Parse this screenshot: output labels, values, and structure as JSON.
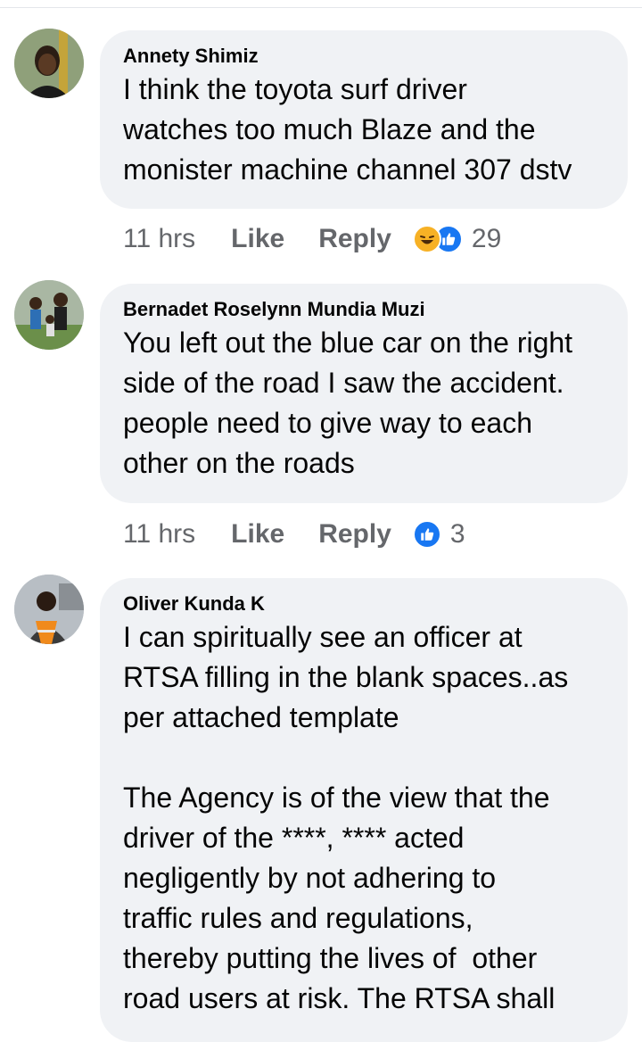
{
  "comments": [
    {
      "author": "Annety Shimiz",
      "text": "I think the toyota surf driver\nwatches too much Blaze and the\nmonister machine channel 307 dstv",
      "time": "11 hrs",
      "like_label": "Like",
      "reply_label": "Reply",
      "reactions": [
        "haha-icon",
        "like-icon"
      ],
      "reaction_count": "29"
    },
    {
      "author": "Bernadet Roselynn Mundia Muzi",
      "text": "You left out the blue car on the right\nside of the road I saw the accident.\npeople need to give way to each\nother on the roads",
      "time": "11 hrs",
      "like_label": "Like",
      "reply_label": "Reply",
      "reactions": [
        "like-icon"
      ],
      "reaction_count": "3"
    },
    {
      "author": "Oliver Kunda K",
      "text": "I can spiritually see an officer at\nRTSA filling in the blank spaces..as\nper attached template\n\nThe Agency is of the view that the\ndriver of the ****, **** acted\nnegligently by not adhering to\ntraffic rules and regulations,\nthereby putting the lives of  other\nroad users at risk. The RTSA shall",
      "time": "",
      "like_label": "",
      "reply_label": "",
      "reactions": [],
      "reaction_count": ""
    }
  ],
  "colors": {
    "bubble": "#f0f2f5",
    "meta_text": "#65676b",
    "like_blue": "#1877f2",
    "haha_yellow": "#f7b125"
  }
}
